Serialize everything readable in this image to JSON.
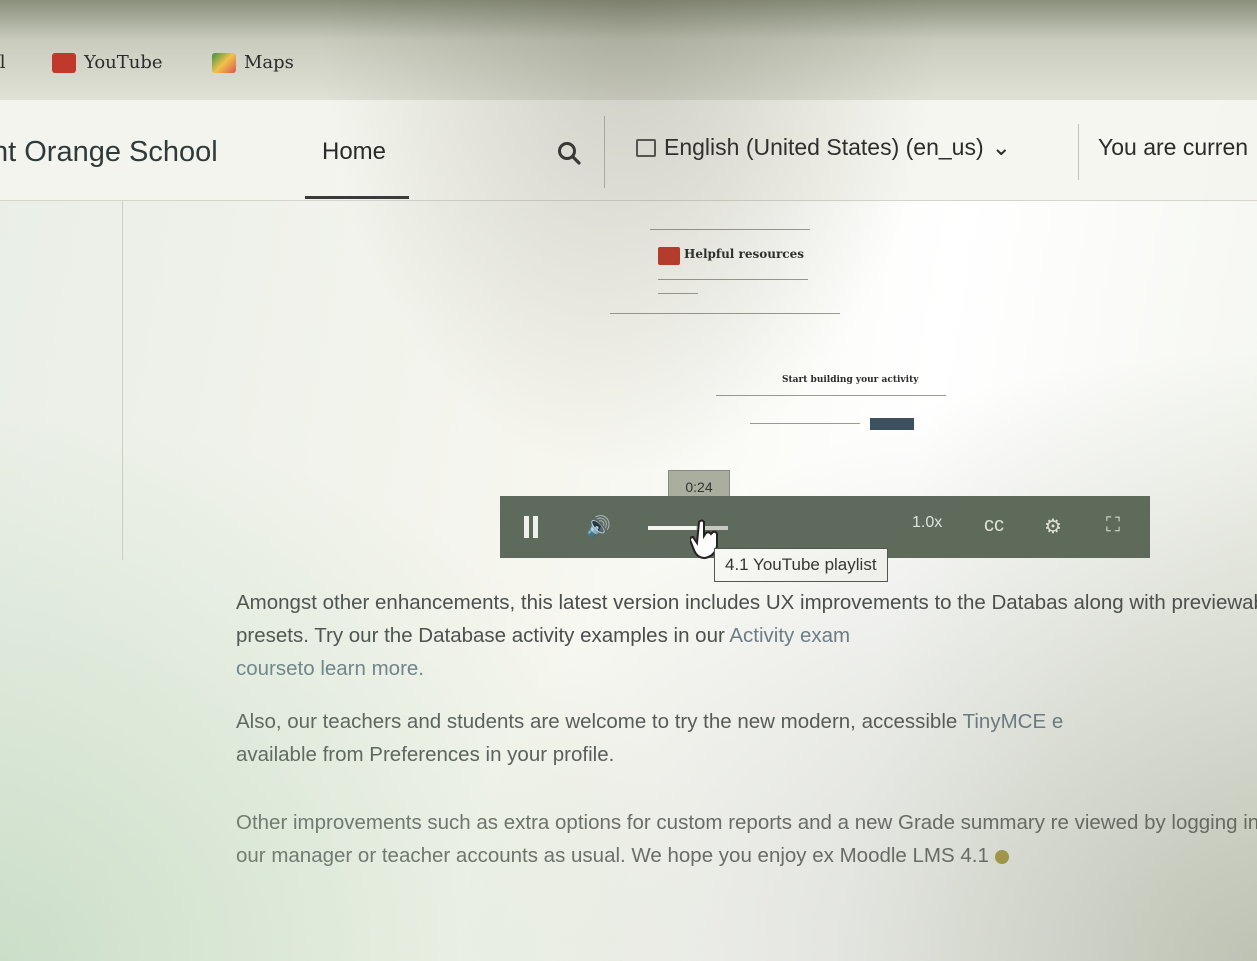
{
  "bookmarks": [
    {
      "label": "il"
    },
    {
      "label": "YouTube"
    },
    {
      "label": "Maps"
    }
  ],
  "navbar": {
    "site_name": "nt Orange School",
    "home_label": "Home",
    "language_label": "English (United States) (en_us)",
    "language_caret": "⌄",
    "login_info": "You are curren"
  },
  "video": {
    "thumb_title": "Helpful resources",
    "thumb_subtitle": "Start building your activity",
    "time_tooltip": "0:24",
    "speed_label": "1.0x",
    "cc_label": "cc",
    "volume_level": 0.6,
    "hover_tooltip": "4.1 YouTube playlist"
  },
  "content": {
    "p1_text": "Amongst other enhancements, this latest version includes UX improvements to the Databas along with previewable presets. Try our the Database activity examples in our ",
    "p1_link": "Activity exam",
    "p1_tail_link": "courseto learn more.",
    "p2_text": "Also, our teachers and students are welcome to try the new modern, accessible ",
    "p2_link": "TinyMCE e",
    "p2_tail": "available from Preferences in your profile.",
    "p3_text": "Other improvements such as extra options for custom reports and a new Grade summary re viewed by logging in with our manager or teacher accounts as usual. We hope you enjoy ex Moodle LMS 4.1"
  },
  "colors": {
    "accent_red": "#c0392b",
    "player_bar": "#5e6a5c",
    "link": "#6e7f8c"
  }
}
